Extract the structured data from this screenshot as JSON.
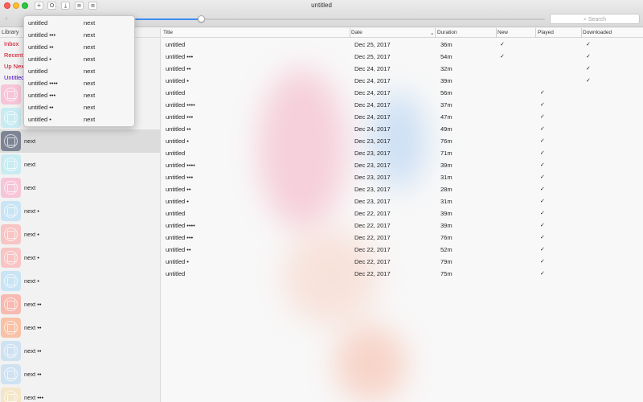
{
  "window": {
    "title": "untitled"
  },
  "toolbar": {
    "buttons": [
      {
        "name": "add-button",
        "icon": "plus-icon",
        "glyph": "+"
      },
      {
        "name": "refresh-button",
        "icon": "circle-icon",
        "glyph": "O"
      },
      {
        "name": "download-button",
        "icon": "download-icon",
        "glyph": "⤓"
      },
      {
        "name": "list-button",
        "icon": "list-icon",
        "glyph": "≡"
      },
      {
        "name": "menu-button",
        "icon": "menu-icon",
        "glyph": "≡"
      }
    ],
    "back_glyph": "‹",
    "progress": 0.16,
    "search_placeholder": "Search",
    "search_icon": "⌕"
  },
  "sidebar": {
    "header": "Library",
    "library_items": [
      {
        "label": "Inbox",
        "color": "#d0021b"
      },
      {
        "label": "Recent",
        "color": "#d0021b"
      },
      {
        "label": "Up Next",
        "color": "#d0021b"
      },
      {
        "label": "Untitled",
        "color": "#4a00c8"
      }
    ],
    "episodes": [
      {
        "title": "",
        "tint": "#f7c5d8"
      },
      {
        "title": "",
        "tint": "#c9ecf2"
      },
      {
        "title": "next",
        "tint": "#7d8594",
        "selected": true
      },
      {
        "title": "next",
        "tint": "#c9ecf2"
      },
      {
        "title": "next",
        "tint": "#f7c5d8"
      },
      {
        "title": "next •",
        "tint": "#c9e4f4"
      },
      {
        "title": "next •",
        "tint": "#f8c4c4"
      },
      {
        "title": "next •",
        "tint": "#f8c4c4"
      },
      {
        "title": "next •",
        "tint": "#c9e4f4"
      },
      {
        "title": "next ••",
        "tint": "#f7b9b0"
      },
      {
        "title": "next ••",
        "tint": "#f9c1a5"
      },
      {
        "title": "next ••",
        "tint": "#cfe2f2"
      },
      {
        "title": "next ••",
        "tint": "#cfe2f2"
      },
      {
        "title": "next •••",
        "tint": "#f4e6c8"
      }
    ]
  },
  "columns": {
    "title": "Title",
    "date": "Date",
    "sort_glyph": "⌄",
    "duration": "Duration",
    "new": "New",
    "played": "Played",
    "downloaded": "Downloaded"
  },
  "rows": [
    {
      "title": "untitled",
      "date": "Dec 25, 2017",
      "duration": "36m",
      "new": "✓",
      "played": "",
      "downloaded": "✓"
    },
    {
      "title": "untitled •••",
      "date": "Dec 25, 2017",
      "duration": "54m",
      "new": "✓",
      "played": "",
      "downloaded": "✓"
    },
    {
      "title": "untitled ••",
      "date": "Dec 24, 2017",
      "duration": "32m",
      "new": "",
      "played": "",
      "downloaded": "✓"
    },
    {
      "title": "untitled •",
      "date": "Dec 24, 2017",
      "duration": "39m",
      "new": "",
      "played": "",
      "downloaded": "✓"
    },
    {
      "title": "untitled",
      "date": "Dec 24, 2017",
      "duration": "56m",
      "new": "",
      "played": "✓",
      "downloaded": ""
    },
    {
      "title": "untitled ••••",
      "date": "Dec 24, 2017",
      "duration": "37m",
      "new": "",
      "played": "✓",
      "downloaded": ""
    },
    {
      "title": "untitled •••",
      "date": "Dec 24, 2017",
      "duration": "47m",
      "new": "",
      "played": "✓",
      "downloaded": ""
    },
    {
      "title": "untitled ••",
      "date": "Dec 24, 2017",
      "duration": "49m",
      "new": "",
      "played": "✓",
      "downloaded": ""
    },
    {
      "title": "untitled •",
      "date": "Dec 23, 2017",
      "duration": "76m",
      "new": "",
      "played": "✓",
      "downloaded": ""
    },
    {
      "title": "untitled",
      "date": "Dec 23, 2017",
      "duration": "71m",
      "new": "",
      "played": "✓",
      "downloaded": ""
    },
    {
      "title": "untitled ••••",
      "date": "Dec 23, 2017",
      "duration": "39m",
      "new": "",
      "played": "✓",
      "downloaded": ""
    },
    {
      "title": "untitled •••",
      "date": "Dec 23, 2017",
      "duration": "31m",
      "new": "",
      "played": "✓",
      "downloaded": ""
    },
    {
      "title": "untitled ••",
      "date": "Dec 23, 2017",
      "duration": "28m",
      "new": "",
      "played": "✓",
      "downloaded": ""
    },
    {
      "title": "untitled •",
      "date": "Dec 23, 2017",
      "duration": "31m",
      "new": "",
      "played": "✓",
      "downloaded": ""
    },
    {
      "title": "untitled",
      "date": "Dec 22, 2017",
      "duration": "39m",
      "new": "",
      "played": "✓",
      "downloaded": ""
    },
    {
      "title": "untitled ••••",
      "date": "Dec 22, 2017",
      "duration": "39m",
      "new": "",
      "played": "✓",
      "downloaded": ""
    },
    {
      "title": "untitled •••",
      "date": "Dec 22, 2017",
      "duration": "76m",
      "new": "",
      "played": "✓",
      "downloaded": ""
    },
    {
      "title": "untitled ••",
      "date": "Dec 22, 2017",
      "duration": "52m",
      "new": "",
      "played": "✓",
      "downloaded": ""
    },
    {
      "title": "untitled •",
      "date": "Dec 22, 2017",
      "duration": "79m",
      "new": "",
      "played": "✓",
      "downloaded": ""
    },
    {
      "title": "untitled",
      "date": "Dec 22, 2017",
      "duration": "75m",
      "new": "",
      "played": "✓",
      "downloaded": ""
    }
  ],
  "dropdown": {
    "items": [
      {
        "title": "untitled",
        "subtitle": "next"
      },
      {
        "title": "untitled •••",
        "subtitle": "next"
      },
      {
        "title": "untitled ••",
        "subtitle": "next"
      },
      {
        "title": "untitled •",
        "subtitle": "next"
      },
      {
        "title": "untitled",
        "subtitle": "next"
      },
      {
        "title": "untitled ••••",
        "subtitle": "next"
      },
      {
        "title": "untitled •••",
        "subtitle": "next"
      },
      {
        "title": "untitled ••",
        "subtitle": "next"
      },
      {
        "title": "untitled •",
        "subtitle": "next"
      }
    ]
  }
}
